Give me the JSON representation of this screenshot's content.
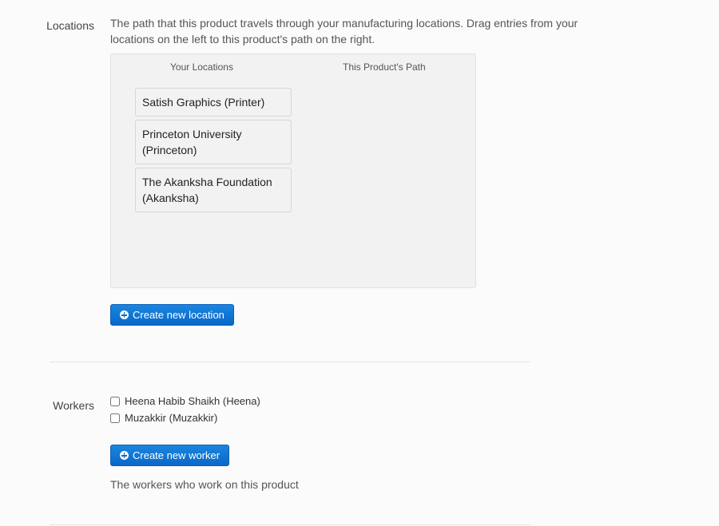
{
  "locations_section": {
    "label": "Locations",
    "help": "The path that this product travels through your manufacturing locations. Drag entries from your locations on the left to this product's path on the right.",
    "your_locations_header": "Your Locations",
    "product_path_header": "This Product's Path",
    "your_locations": [
      "Satish Graphics (Printer)",
      "Princeton University (Princeton)",
      "The Akanksha Foundation (Akanksha)"
    ],
    "product_path": [],
    "create_button_label": "Create new location"
  },
  "workers_section": {
    "label": "Workers",
    "workers": [
      {
        "name": "Heena Habib Shaikh (Heena)",
        "checked": false
      },
      {
        "name": "Muzakkir (Muzakkir)",
        "checked": false
      }
    ],
    "create_button_label": "Create new worker",
    "help": "The workers who work on this product"
  },
  "colors": {
    "primary_button": "#0a68c8",
    "panel_background": "#f2f2f2"
  },
  "icons": {
    "create_button_icon": "plus-circle-icon"
  }
}
